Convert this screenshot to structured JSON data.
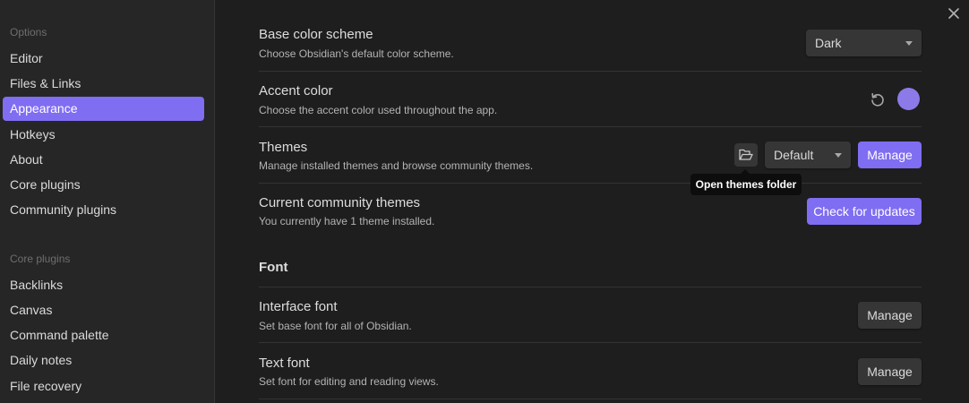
{
  "sidebar": {
    "options_heading": "Options",
    "options_items": [
      {
        "label": "Editor"
      },
      {
        "label": "Files & Links"
      },
      {
        "label": "Appearance",
        "active": true
      },
      {
        "label": "Hotkeys"
      },
      {
        "label": "About"
      },
      {
        "label": "Core plugins"
      },
      {
        "label": "Community plugins"
      }
    ],
    "core_heading": "Core plugins",
    "core_items": [
      {
        "label": "Backlinks"
      },
      {
        "label": "Canvas"
      },
      {
        "label": "Command palette"
      },
      {
        "label": "Daily notes"
      },
      {
        "label": "File recovery"
      }
    ]
  },
  "window": {
    "close_icon": "close-icon"
  },
  "settings": {
    "base_color_scheme": {
      "title": "Base color scheme",
      "desc": "Choose Obsidian's default color scheme.",
      "value": "Dark"
    },
    "accent_color": {
      "title": "Accent color",
      "desc": "Choose the accent color used throughout the app.",
      "reset_icon": "reset-icon",
      "swatch_color": "#8b7ae8"
    },
    "themes": {
      "title": "Themes",
      "desc": "Manage installed themes and browse community themes.",
      "folder_icon": "folder-open-icon",
      "selected": "Default",
      "manage_label": "Manage",
      "tooltip": "Open themes folder"
    },
    "community_themes": {
      "title": "Current community themes",
      "desc": "You currently have 1 theme installed.",
      "button_label": "Check for updates"
    },
    "font_heading": "Font",
    "interface_font": {
      "title": "Interface font",
      "desc": "Set base font for all of Obsidian.",
      "button_label": "Manage"
    },
    "text_font": {
      "title": "Text font",
      "desc": "Set font for editing and reading views.",
      "button_label": "Manage"
    }
  },
  "colors": {
    "accent": "#7f6df2",
    "background": "#1e1e1e",
    "sidebar_background": "#262626"
  }
}
